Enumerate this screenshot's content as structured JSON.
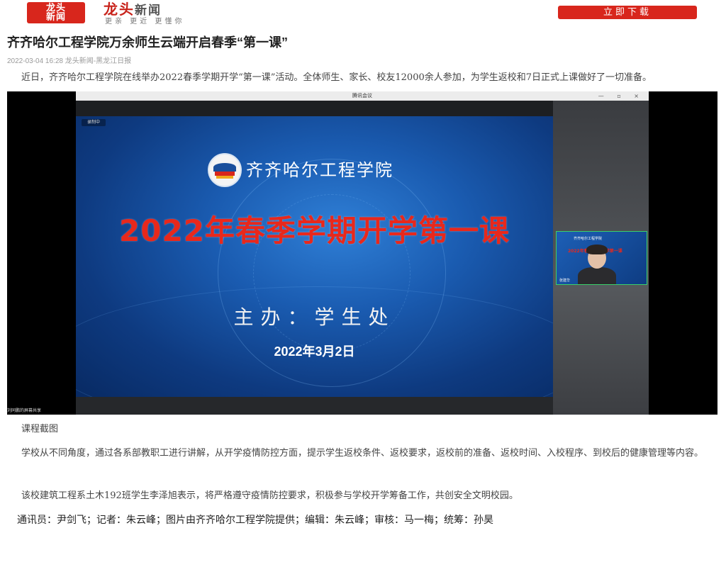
{
  "header": {
    "logo_line1": "龙头",
    "logo_line2": "新闻",
    "brand_part1": "龙头",
    "brand_part2": "新闻",
    "slogan": "更亲 更近 更懂你",
    "download_label": "立即下载"
  },
  "article": {
    "title": "齐齐哈尔工程学院万余师生云端开启春季“第一课”",
    "meta": "2022-03-04 16:28 龙头新闻-黑龙江日报",
    "paragraph1": "近日，齐齐哈尔工程学院在线举办2022春季学期开学“第一课”活动。全体师生、家长、校友12000余人参加，为学生返校和7日正式上课做好了一切准备。",
    "caption": "课程截图",
    "paragraph2": "学校从不同角度，通过各系部教职工进行讲解，从开学疫情防控方面，提示学生返校条件、返校要求，返校前的准备、返校时间、入校程序、到校后的健康管理等内容。",
    "paragraph3": "该校建筑工程系土木192班学生李泽旭表示，将严格遵守疫情防控要求，积极参与学校开学筹备工作，共创安全文明校园。",
    "credits": "通讯员：尹剑飞；记者：朱云峰；图片由齐齐哈尔工程学院提供；编辑：朱云峰；审核：马一梅；统筹：孙昊"
  },
  "screenshot": {
    "window_title": "腾讯会议",
    "window_controls": "— ▫ ×",
    "recording_label": "录制中",
    "school_name": "齐齐哈尔工程学院",
    "slide_title": "2022年春季学期开学第一课",
    "slide_host": "主办：学生处",
    "slide_date": "2022年3月2日",
    "share_status": "刘同鹏的屏幕共享",
    "pip_title": "齐齐哈尔工程学院",
    "pip_subtitle": "2022年春季学期开学第一课",
    "pip_label": "张建华"
  },
  "colors": {
    "brand_red": "#d8261c",
    "slide_title_red": "#e8281c",
    "slide_blue": "#1a5bb0"
  }
}
